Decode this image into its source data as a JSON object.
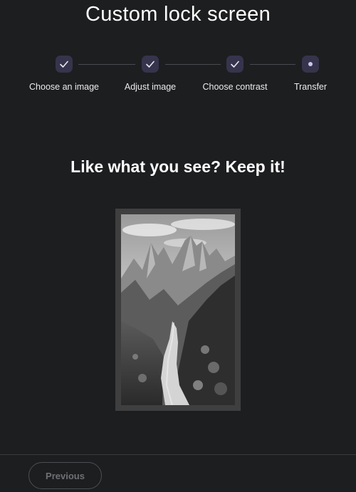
{
  "page": {
    "title": "Custom lock screen"
  },
  "stepper": {
    "steps": [
      {
        "label": "Choose an image",
        "state": "completed",
        "icon": "check-icon"
      },
      {
        "label": "Adjust image",
        "state": "completed",
        "icon": "check-icon"
      },
      {
        "label": "Choose contrast",
        "state": "completed",
        "icon": "check-icon"
      },
      {
        "label": "Transfer",
        "state": "current",
        "icon": "dot-icon"
      }
    ]
  },
  "main": {
    "heading": "Like what you see? Keep it!",
    "preview_image": "grayscale mountain trail photo"
  },
  "footer": {
    "previous_label": "Previous"
  },
  "colors": {
    "background": "#1d1e20",
    "step_badge": "#36344c",
    "step_dot": "#c9c6ee",
    "frame": "#3f3f40"
  }
}
